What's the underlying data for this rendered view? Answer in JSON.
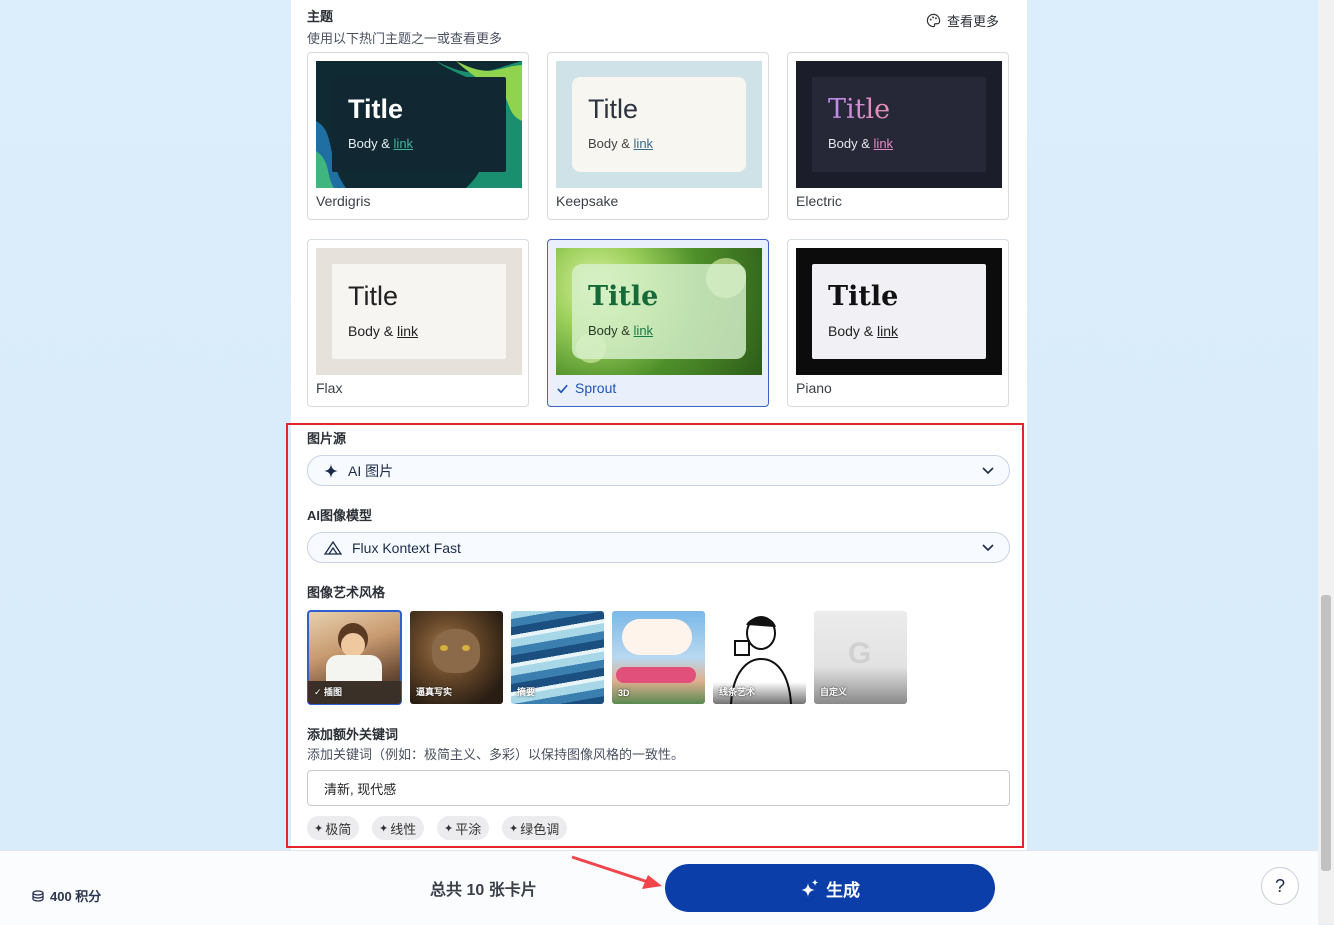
{
  "theme": {
    "title": "主题",
    "subtitle": "使用以下热门主题之一或查看更多",
    "more_label": "查看更多",
    "cards": [
      {
        "name": "Verdigris",
        "title": "Title",
        "body": "Body &",
        "link": "link"
      },
      {
        "name": "Keepsake",
        "title": "Title",
        "body": "Body &",
        "link": "link"
      },
      {
        "name": "Electric",
        "title": "Title",
        "body": "Body &",
        "link": "link"
      },
      {
        "name": "Flax",
        "title": "Title",
        "body": "Body &",
        "link": "link"
      },
      {
        "name": "Sprout",
        "title": "Title",
        "body": "Body &",
        "link": "link",
        "selected": true
      },
      {
        "name": "Piano",
        "title": "Title",
        "body": "Body &",
        "link": "link"
      }
    ]
  },
  "image_source": {
    "label": "图片源",
    "value": "AI 图片"
  },
  "ai_model": {
    "label": "AI图像模型",
    "value": "Flux Kontext Fast"
  },
  "art_style": {
    "label": "图像艺术风格",
    "tiles": [
      {
        "name": "插图",
        "selected": true
      },
      {
        "name": "逼真写实"
      },
      {
        "name": "摘要"
      },
      {
        "name": "3D"
      },
      {
        "name": "线条艺术"
      },
      {
        "name": "自定义"
      }
    ]
  },
  "keywords": {
    "label": "添加额外关键词",
    "hint": "添加关键词（例如：极简主义、多彩）以保持图像风格的一致性。",
    "value": "清新, 现代感",
    "chips": [
      "极简",
      "线性",
      "平涂",
      "绿色调"
    ]
  },
  "footer": {
    "credits": "400 积分",
    "total": "总共 10 张卡片",
    "generate_label": "生成",
    "help_label": "?"
  },
  "colors": {
    "accent": "#0b3ea8",
    "highlight_frame": "#e4262c",
    "annotation_arrow": "#f0464b"
  }
}
